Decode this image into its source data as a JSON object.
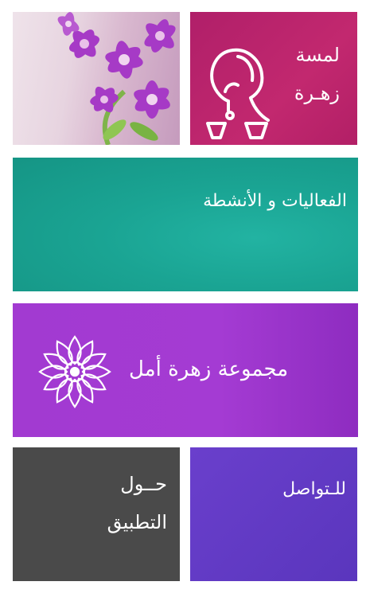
{
  "tiles": {
    "lamsa": {
      "line1": "لمسة",
      "line2": "زهـرة"
    },
    "events": {
      "label": "الفعاليات و الأنشطة"
    },
    "group": {
      "label": "مجموعة زهرة أمل"
    },
    "about": {
      "line1": "حــول",
      "line2": "التطبيق"
    },
    "contact": {
      "label": "للـتواصل"
    }
  },
  "colors": {
    "lamsa": "#b01f69",
    "events": "#1aa493",
    "group": "#a23ad1",
    "about": "#4a4a4a",
    "contact": "#5f39c2"
  },
  "icons": {
    "flower_photo": "orchid-photo",
    "lamsa_icon": "woman-profile-icon",
    "group_logo": "flower-mandala-icon"
  }
}
